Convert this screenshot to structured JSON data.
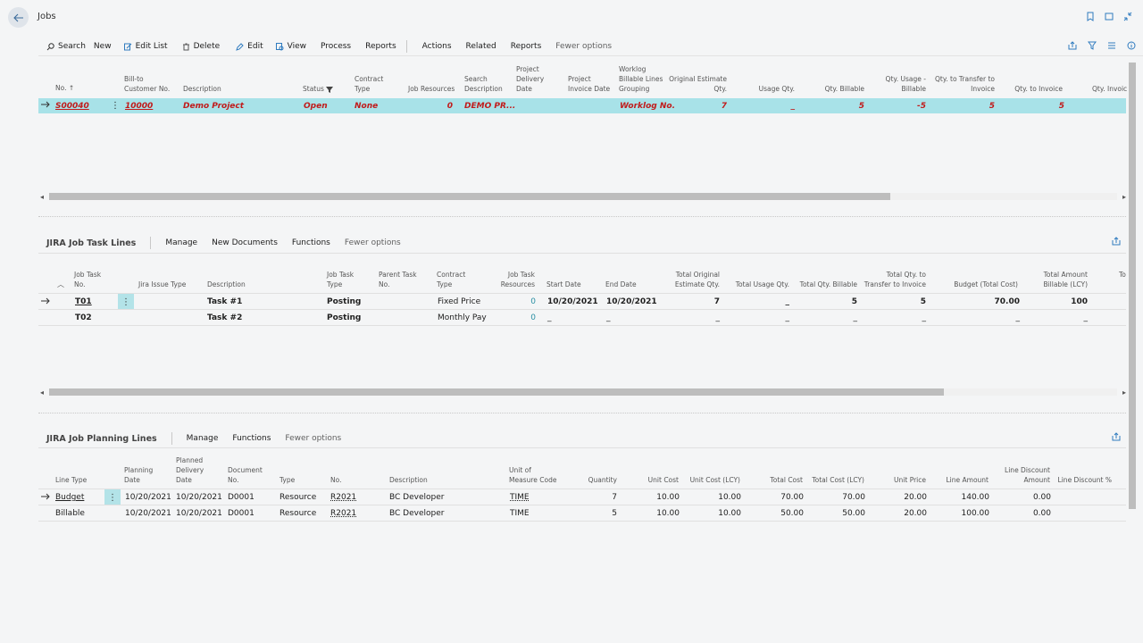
{
  "app": {
    "title": "Jobs"
  },
  "toolbar": {
    "search": "Search",
    "new": "New",
    "edit_list": "Edit List",
    "delete": "Delete",
    "edit": "Edit",
    "view": "View",
    "process": "Process",
    "reports": "Reports",
    "actions": "Actions",
    "related": "Related",
    "reports2": "Reports",
    "fewer": "Fewer options"
  },
  "jobs": {
    "headers": {
      "no": "No. ↑",
      "billto1": "Bill-to",
      "billto2": "Customer No.",
      "desc": "Description",
      "status": "Status",
      "contract1": "Contract",
      "contract2": "Type",
      "resources": "Job Resources",
      "search1": "Search",
      "search2": "Description",
      "pdd1": "Project",
      "pdd2": "Delivery",
      "pdd3": "Date",
      "pid1": "Project",
      "pid2": "Invoice Date",
      "wl1": "Worklog",
      "wl2": "Billable Lines",
      "wl3": "Grouping",
      "oe1": "Original Estimate",
      "oe2": "Qty.",
      "usage": "Usage Qty.",
      "billable": "Qty. Billable",
      "qub1": "Qty. Usage -",
      "qub2": "Billable",
      "qtt1": "Qty. to Transfer to",
      "qtt2": "Invoice",
      "qti": "Qty. to Invoice",
      "qinv": "Qty. Invoic"
    },
    "row": {
      "no": "S00040",
      "billto": "10000",
      "desc": "Demo Project",
      "status": "Open",
      "contract": "None",
      "resources": "0",
      "search": "DEMO PR...",
      "worklog": "Worklog No.",
      "orig": "7",
      "usage": "_",
      "billable": "5",
      "usage_billable": "-5",
      "to_transfer": "5",
      "to_invoice": "5"
    }
  },
  "tasks": {
    "title": "JIRA Job Task Lines",
    "manage": "Manage",
    "newdocs": "New Documents",
    "functions": "Functions",
    "fewer": "Fewer options",
    "headers": {
      "no1": "Job Task",
      "no2": "No.",
      "jira": "Jira Issue Type",
      "desc": "Description",
      "type1": "Job Task",
      "type2": "Type",
      "parent1": "Parent Task",
      "parent2": "No.",
      "ct1": "Contract",
      "ct2": "Type",
      "res1": "Job Task",
      "res2": "Resources",
      "start": "Start Date",
      "end": "End Date",
      "toe1": "Total Original",
      "toe2": "Estimate Qty.",
      "tuq": "Total Usage Qty.",
      "tqb": "Total Qty. Billable",
      "tqt1": "Total Qty. to",
      "tqt2": "Transfer to Invoice",
      "budget": "Budget (Total Cost)",
      "tab1": "Total Amount",
      "tab2": "Billable (LCY)",
      "to": "To"
    },
    "rows": [
      {
        "no": "T01",
        "desc": "Task #1",
        "type": "Posting",
        "contract": "Fixed Price",
        "res": "0",
        "start": "10/20/2021",
        "end": "10/20/2021",
        "toe": "7",
        "tuq": "_",
        "tqb": "5",
        "tqt": "5",
        "budget": "70.00",
        "tab": "100"
      },
      {
        "no": "T02",
        "desc": "Task #2",
        "type": "Posting",
        "contract": "Monthly Pay",
        "res": "0",
        "start": "_",
        "end": "_",
        "toe": "_",
        "tuq": "_",
        "tqb": "_",
        "tqt": "_",
        "budget": "_",
        "tab": "_"
      }
    ]
  },
  "planning": {
    "title": "JIRA Job Planning Lines",
    "manage": "Manage",
    "functions": "Functions",
    "fewer": "Fewer options",
    "headers": {
      "lt": "Line Type",
      "pd1": "Planning",
      "pd2": "Date",
      "pdd1": "Planned",
      "pdd2": "Delivery",
      "pdd3": "Date",
      "doc1": "Document",
      "doc2": "No.",
      "type": "Type",
      "no": "No.",
      "desc": "Description",
      "uom1": "Unit of",
      "uom2": "Measure Code",
      "qty": "Quantity",
      "uc": "Unit Cost",
      "ucl": "Unit Cost (LCY)",
      "tc": "Total Cost",
      "tcl": "Total Cost (LCY)",
      "up": "Unit Price",
      "la": "Line Amount",
      "lda1": "Line Discount",
      "lda2": "Amount",
      "ldp": "Line Discount %"
    },
    "rows": [
      {
        "lt": "Budget",
        "pd": "10/20/2021",
        "pdd": "10/20/2021",
        "doc": "D0001",
        "type": "Resource",
        "no": "R2021",
        "desc": "BC Developer",
        "uom": "TIME",
        "qty": "7",
        "uc": "10.00",
        "ucl": "10.00",
        "tc": "70.00",
        "tcl": "70.00",
        "up": "20.00",
        "la": "140.00",
        "lda": "0.00"
      },
      {
        "lt": "Billable",
        "pd": "10/20/2021",
        "pdd": "10/20/2021",
        "doc": "D0001",
        "type": "Resource",
        "no": "R2021",
        "desc": "BC Developer",
        "uom": "TIME",
        "qty": "5",
        "uc": "10.00",
        "ucl": "10.00",
        "tc": "50.00",
        "tcl": "50.00",
        "up": "20.00",
        "la": "100.00",
        "lda": "0.00"
      }
    ]
  }
}
